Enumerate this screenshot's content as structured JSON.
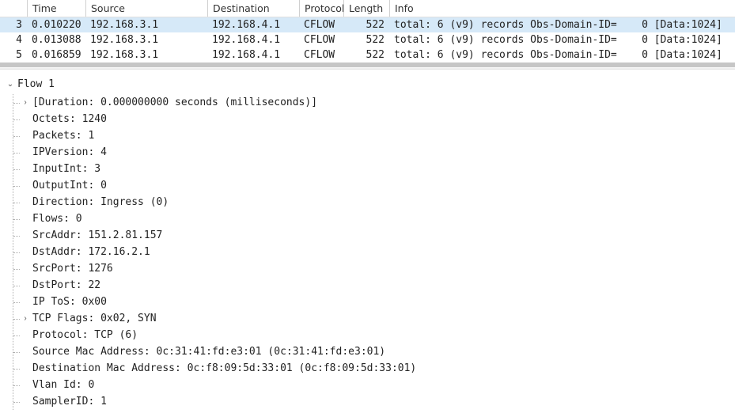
{
  "packet_list": {
    "columns": {
      "no": "",
      "time": "Time",
      "source": "Source",
      "destination": "Destination",
      "protocol": "Protocol",
      "length": "Length",
      "info": "Info"
    },
    "rows": [
      {
        "no": "3",
        "time": "0.010220",
        "src": "192.168.3.1",
        "dst": "192.168.4.1",
        "proto": "CFLOW",
        "len": "522",
        "info": "total: 6 (v9) records Obs-Domain-ID=    0 [Data:1024]",
        "selected": true
      },
      {
        "no": "4",
        "time": "0.013088",
        "src": "192.168.3.1",
        "dst": "192.168.4.1",
        "proto": "CFLOW",
        "len": "522",
        "info": "total: 6 (v9) records Obs-Domain-ID=    0 [Data:1024]",
        "selected": false
      },
      {
        "no": "5",
        "time": "0.016859",
        "src": "192.168.3.1",
        "dst": "192.168.4.1",
        "proto": "CFLOW",
        "len": "522",
        "info": "total: 6 (v9) records Obs-Domain-ID=    0 [Data:1024]",
        "selected": false
      }
    ]
  },
  "detail": {
    "root_label": "Flow 1",
    "children": [
      {
        "toggle": "expand",
        "label": "[Duration: 0.000000000 seconds (milliseconds)]"
      },
      {
        "toggle": null,
        "label": "Octets: 1240"
      },
      {
        "toggle": null,
        "label": "Packets: 1"
      },
      {
        "toggle": null,
        "label": "IPVersion: 4"
      },
      {
        "toggle": null,
        "label": "InputInt: 3"
      },
      {
        "toggle": null,
        "label": "OutputInt: 0"
      },
      {
        "toggle": null,
        "label": "Direction: Ingress (0)"
      },
      {
        "toggle": null,
        "label": "Flows: 0"
      },
      {
        "toggle": null,
        "label": "SrcAddr: 151.2.81.157"
      },
      {
        "toggle": null,
        "label": "DstAddr: 172.16.2.1"
      },
      {
        "toggle": null,
        "label": "SrcPort: 1276"
      },
      {
        "toggle": null,
        "label": "DstPort: 22"
      },
      {
        "toggle": null,
        "label": "IP ToS: 0x00"
      },
      {
        "toggle": "expand",
        "label": "TCP Flags: 0x02, SYN"
      },
      {
        "toggle": null,
        "label": "Protocol: TCP (6)"
      },
      {
        "toggle": null,
        "label": "Source Mac Address: 0c:31:41:fd:e3:01 (0c:31:41:fd:e3:01)"
      },
      {
        "toggle": null,
        "label": "Destination Mac Address: 0c:f8:09:5d:33:01 (0c:f8:09:5d:33:01)"
      },
      {
        "toggle": null,
        "label": "Vlan Id: 0"
      },
      {
        "toggle": null,
        "label": "SamplerID: 1"
      }
    ]
  }
}
